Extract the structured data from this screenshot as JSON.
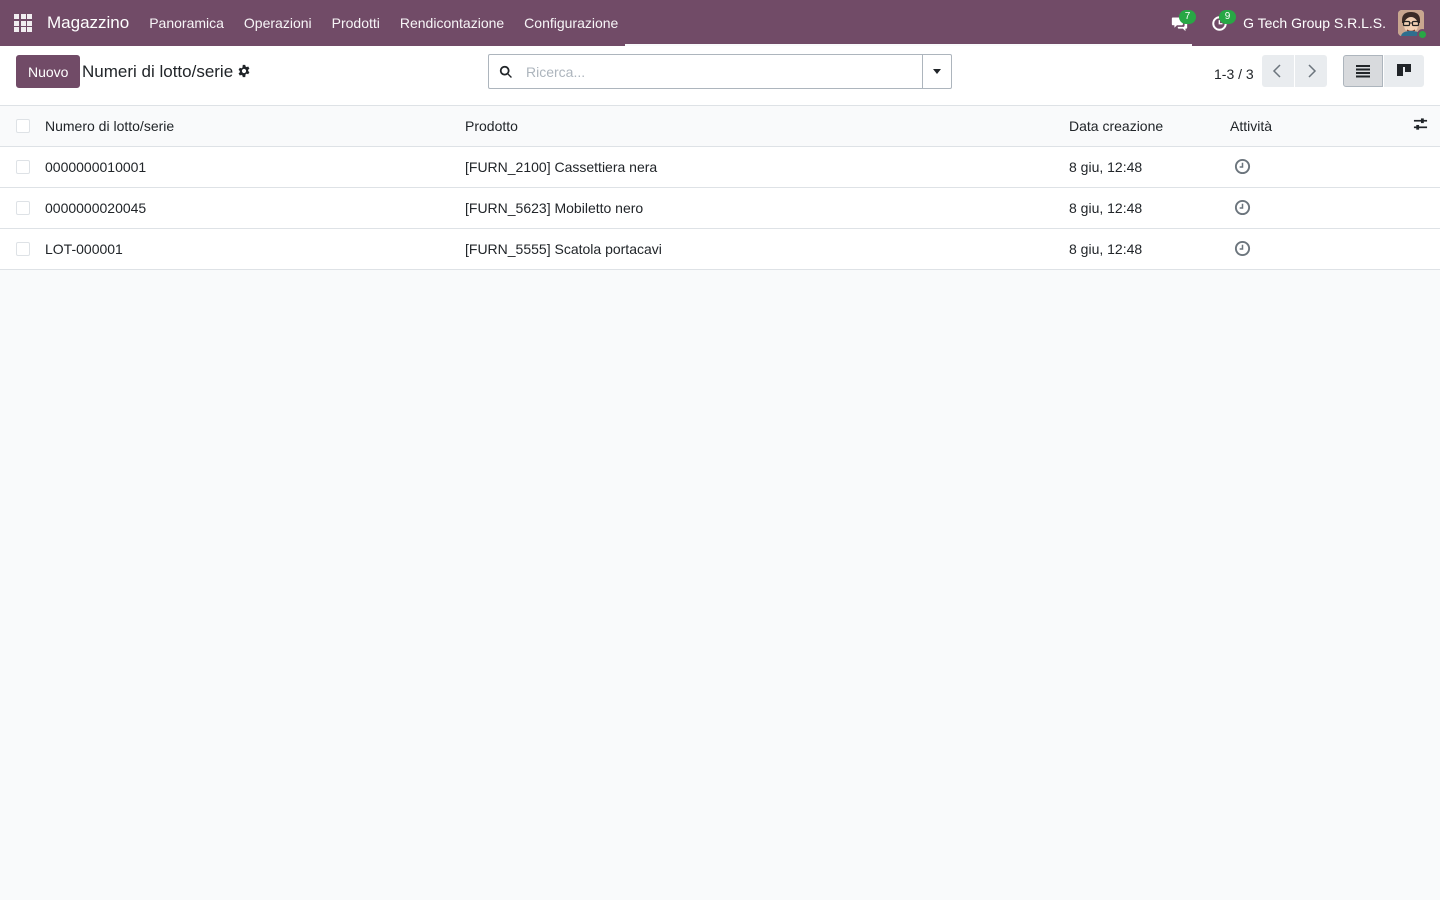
{
  "navbar": {
    "app_name": "Magazzino",
    "menu": [
      "Panoramica",
      "Operazioni",
      "Prodotti",
      "Rendicontazione",
      "Configurazione"
    ],
    "messages_badge": "7",
    "activities_badge": "9",
    "company": "G Tech Group S.R.L.S."
  },
  "control_panel": {
    "new_label": "Nuovo",
    "title": "Numeri di lotto/serie",
    "search_placeholder": "Ricerca...",
    "pager": "1-3 / 3"
  },
  "table": {
    "columns": [
      "Numero di lotto/serie",
      "Prodotto",
      "Data creazione",
      "Attività"
    ],
    "rows": [
      {
        "lot": "0000000010001",
        "product": "[FURN_2100] Cassettiera nera",
        "date": "8 giu, 12:48"
      },
      {
        "lot": "0000000020045",
        "product": "[FURN_5623] Mobiletto nero",
        "date": "8 giu, 12:48"
      },
      {
        "lot": "LOT-000001",
        "product": "[FURN_5555] Scatola portacavi",
        "date": "8 giu, 12:48"
      }
    ]
  },
  "colors": {
    "brand": "#714b67",
    "badge": "#28a745"
  },
  "icons": {
    "apps": "apps-grid-icon",
    "messages": "chat-icon",
    "activities": "clock-icon",
    "settings": "gear-icon",
    "search": "search-icon",
    "list_view": "list-view-icon",
    "kanban_view": "kanban-view-icon",
    "optional_columns": "sliders-icon"
  }
}
